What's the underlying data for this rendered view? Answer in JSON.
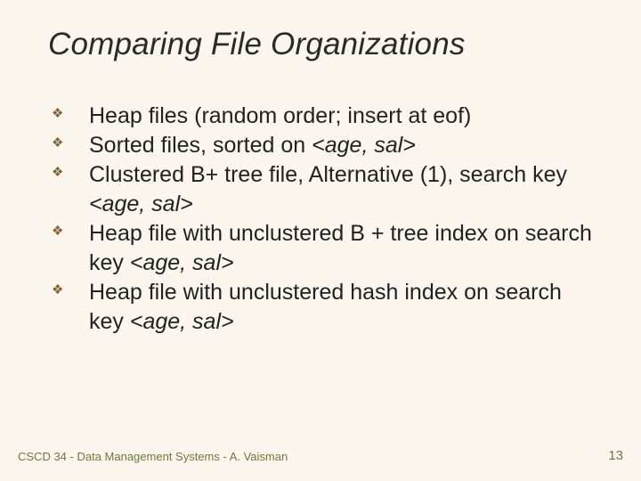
{
  "title": "Comparing File Organizations",
  "bullets": [
    {
      "pre": "Heap files (random order; insert at eof)",
      "key": ""
    },
    {
      "pre": "Sorted files, sorted on ",
      "key": "<age, sal>"
    },
    {
      "pre": "Clustered B+ tree file, Alternative (1), search key ",
      "key": "<age, sal>"
    },
    {
      "pre": "Heap file with unclustered B + tree index on search key ",
      "key": "<age, sal>"
    },
    {
      "pre": "Heap file with unclustered hash index on search key ",
      "key": "<age, sal>"
    }
  ],
  "footer": {
    "left": "CSCD 34 - Data Management Systems - A. Vaisman",
    "right": "13"
  },
  "icons": {
    "bullet_glyph": "❖"
  }
}
